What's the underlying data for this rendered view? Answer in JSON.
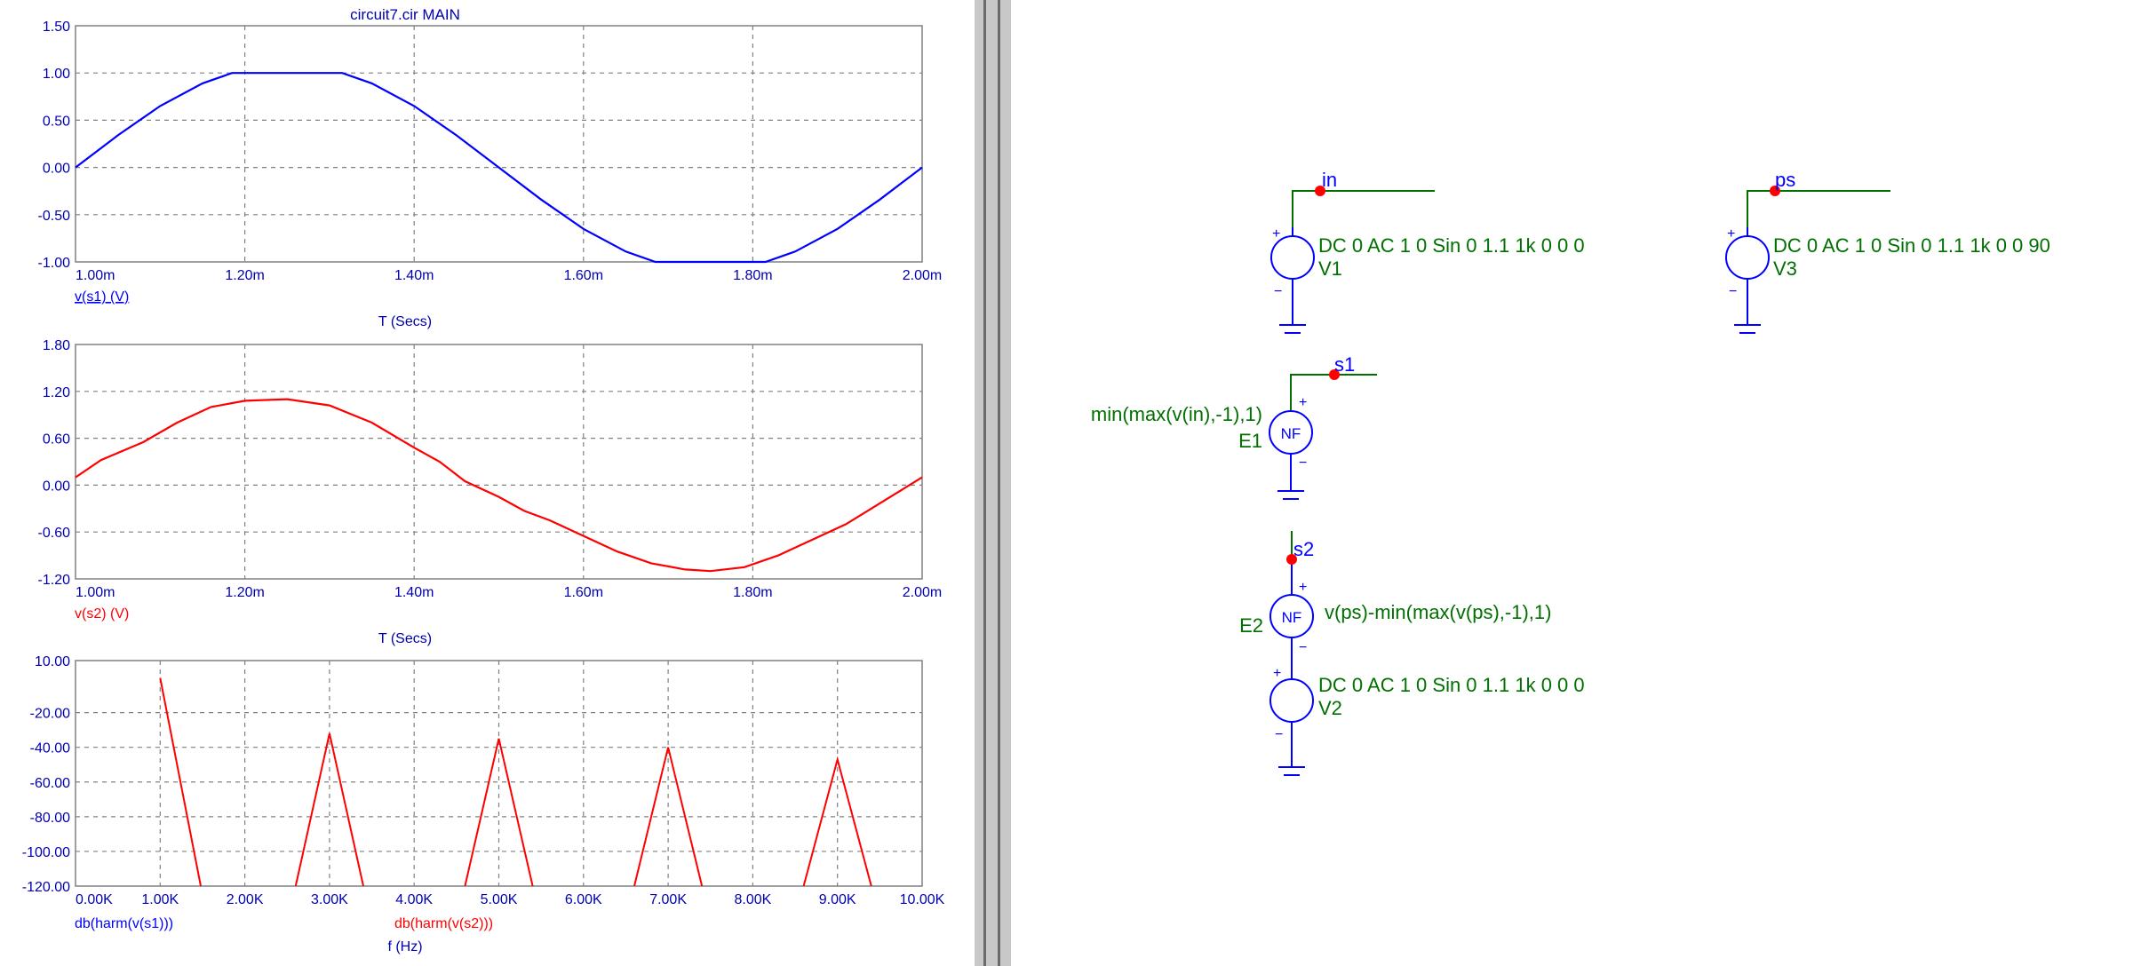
{
  "plot_window": {
    "title": "circuit7.cir MAIN",
    "colors": {
      "blue": "#0000ff",
      "red": "#ff0000",
      "grid": "#808080",
      "axis_text": "#0000b0"
    }
  },
  "chart_data": [
    {
      "type": "line",
      "ylim": [
        -1.0,
        1.5
      ],
      "xlim": [
        1.0,
        2.0
      ],
      "y_ticks": [
        "1.50",
        "1.00",
        "0.50",
        "0.00",
        "-0.50",
        "-1.00"
      ],
      "x_ticks": [
        "1.00m",
        "1.20m",
        "1.40m",
        "1.60m",
        "1.80m",
        "2.00m"
      ],
      "xlabel": "T (Secs)",
      "series": [
        {
          "name": "v(s1) (V)",
          "color": "#0000ff",
          "x": [
            1.0,
            1.05,
            1.1,
            1.15,
            1.185,
            1.2,
            1.25,
            1.3,
            1.315,
            1.35,
            1.4,
            1.45,
            1.5,
            1.55,
            1.6,
            1.65,
            1.685,
            1.7,
            1.75,
            1.8,
            1.815,
            1.85,
            1.9,
            1.95,
            2.0
          ],
          "y": [
            0.0,
            0.34,
            0.65,
            0.89,
            1.0,
            1.0,
            1.0,
            1.0,
            1.0,
            0.89,
            0.65,
            0.34,
            0.0,
            -0.34,
            -0.65,
            -0.89,
            -1.0,
            -1.0,
            -1.0,
            -1.0,
            -1.0,
            -0.89,
            -0.65,
            -0.34,
            0.0
          ]
        }
      ]
    },
    {
      "type": "line",
      "ylim": [
        -1.2,
        1.8
      ],
      "xlim": [
        1.0,
        2.0
      ],
      "y_ticks": [
        "1.80",
        "1.20",
        "0.60",
        "0.00",
        "-0.60",
        "-1.20"
      ],
      "x_ticks": [
        "1.00m",
        "1.20m",
        "1.40m",
        "1.60m",
        "1.80m",
        "2.00m"
      ],
      "xlabel": "T (Secs)",
      "series": [
        {
          "name": "v(s2) (V)",
          "color": "#ff0000",
          "x": [
            1.0,
            1.03,
            1.08,
            1.12,
            1.16,
            1.2,
            1.25,
            1.3,
            1.35,
            1.4,
            1.43,
            1.46,
            1.5,
            1.53,
            1.56,
            1.6,
            1.64,
            1.68,
            1.72,
            1.75,
            1.79,
            1.83,
            1.87,
            1.91,
            1.94,
            1.97,
            2.0
          ],
          "y": [
            0.1,
            0.32,
            0.55,
            0.8,
            1.0,
            1.08,
            1.1,
            1.02,
            0.8,
            0.48,
            0.3,
            0.05,
            -0.15,
            -0.33,
            -0.45,
            -0.65,
            -0.85,
            -1.0,
            -1.08,
            -1.1,
            -1.05,
            -0.9,
            -0.7,
            -0.5,
            -0.3,
            -0.1,
            0.1
          ]
        }
      ]
    },
    {
      "type": "line",
      "ylim": [
        -120,
        10
      ],
      "xlim": [
        0,
        10
      ],
      "y_ticks": [
        "10.00",
        "-20.00",
        "-40.00",
        "-60.00",
        "-80.00",
        "-100.00",
        "-120.00"
      ],
      "y_tick_values": [
        10,
        -20,
        -40,
        -60,
        -80,
        -100,
        -120
      ],
      "x_ticks": [
        "0.00K",
        "1.00K",
        "2.00K",
        "3.00K",
        "4.00K",
        "5.00K",
        "6.00K",
        "7.00K",
        "8.00K",
        "9.00K",
        "10.00K"
      ],
      "xlabel": "f (Hz)",
      "series": [
        {
          "name": "db(harm(v(s1)))",
          "color": "#0000ff",
          "x": [],
          "y": []
        },
        {
          "name": "db(harm(v(s2)))",
          "color": "#ff0000",
          "segments": [
            {
              "x": [
                1.0,
                1.48
              ],
              "y": [
                0.0,
                -120
              ]
            },
            {
              "x": [
                2.6,
                3.0,
                3.4
              ],
              "y": [
                -120,
                -32,
                -120
              ]
            },
            {
              "x": [
                4.6,
                5.0,
                5.4
              ],
              "y": [
                -120,
                -35,
                -120
              ]
            },
            {
              "x": [
                6.6,
                7.0,
                7.4
              ],
              "y": [
                -120,
                -40,
                -120
              ]
            },
            {
              "x": [
                8.6,
                9.0,
                9.4
              ],
              "y": [
                -120,
                -47,
                -120
              ]
            }
          ]
        }
      ]
    }
  ],
  "schematic": {
    "color_wire": "#007000",
    "color_symbol": "#0000ff",
    "color_node": "#ff0000",
    "nodes": {
      "in": "in",
      "ps": "ps",
      "s1": "s1",
      "s2": "s2"
    },
    "V1": {
      "name": "V1",
      "value": "DC 0 AC 1 0 Sin 0 1.1 1k 0 0 0"
    },
    "V3": {
      "name": "V3",
      "value": "DC 0 AC 1 0 Sin 0 1.1 1k 0 0 90"
    },
    "E1": {
      "name": "E1",
      "expr": "min(max(v(in),-1),1)",
      "symbol": "NF"
    },
    "E2": {
      "name": "E2",
      "expr": "v(ps)-min(max(v(ps),-1),1)",
      "symbol": "NF"
    },
    "V2": {
      "name": "V2",
      "value": "DC 0 AC 1 0 Sin 0 1.1 1k 0 0 0"
    },
    "plus": "+",
    "minus": "−"
  }
}
